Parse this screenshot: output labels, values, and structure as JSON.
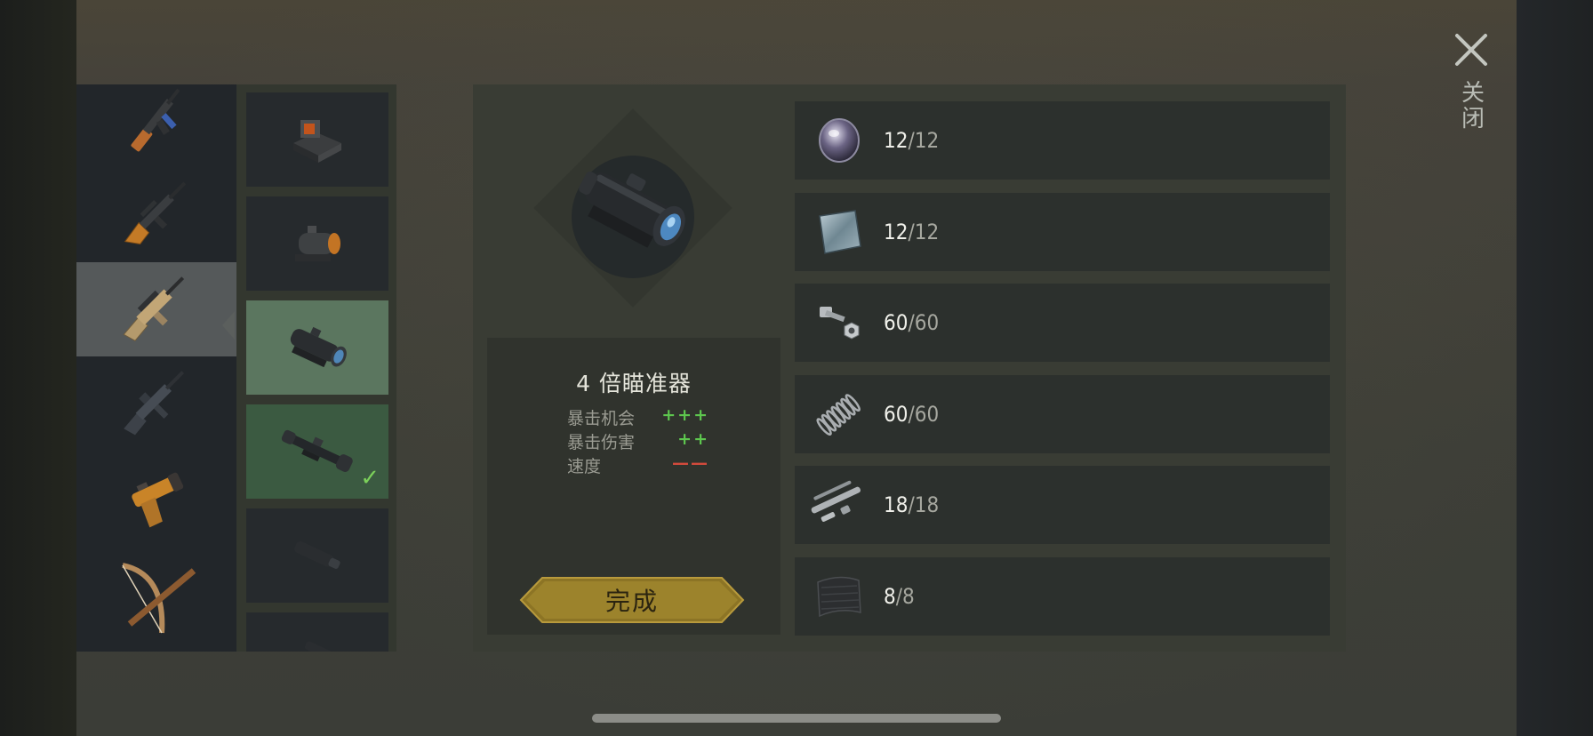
{
  "weapons": [
    {
      "name": "ak-rifle"
    },
    {
      "name": "dragunov-rifle"
    },
    {
      "name": "scar-rifle",
      "selected": true
    },
    {
      "name": "m16-rifle"
    },
    {
      "name": "flare-pistol"
    },
    {
      "name": "crossbow"
    }
  ],
  "attachments": [
    {
      "name": "holographic-sight"
    },
    {
      "name": "red-dot-sight"
    },
    {
      "name": "acog-scope",
      "highlighted": true
    },
    {
      "name": "sniper-scope",
      "equipped": true
    },
    {
      "name": "suppressor"
    },
    {
      "name": "muzzle-device"
    }
  ],
  "item": {
    "title": "4 倍瞄准器",
    "stats": [
      {
        "label": "暴击机会",
        "value": "+++",
        "kind": "pos"
      },
      {
        "label": "暴击伤害",
        "value": "++",
        "kind": "pos"
      },
      {
        "label": "速度",
        "value": "——",
        "kind": "neg"
      }
    ]
  },
  "done_button": {
    "label": "完成"
  },
  "materials": [
    {
      "icon": "lens-icon",
      "have": "12",
      "need": "12"
    },
    {
      "icon": "metal-plate-icon",
      "have": "12",
      "need": "12"
    },
    {
      "icon": "bolt-nut-icon",
      "have": "60",
      "need": "60"
    },
    {
      "icon": "spring-icon",
      "have": "60",
      "need": "60"
    },
    {
      "icon": "pipe-parts-icon",
      "have": "18",
      "need": "18"
    },
    {
      "icon": "rubber-sheet-icon",
      "have": "8",
      "need": "8"
    }
  ],
  "close": {
    "label": "关闭"
  },
  "colors": {
    "accent_gold": "#9c7f2a",
    "positive": "#5dc64e",
    "negative": "#d24a3c",
    "highlight_green": "#5b765f"
  }
}
